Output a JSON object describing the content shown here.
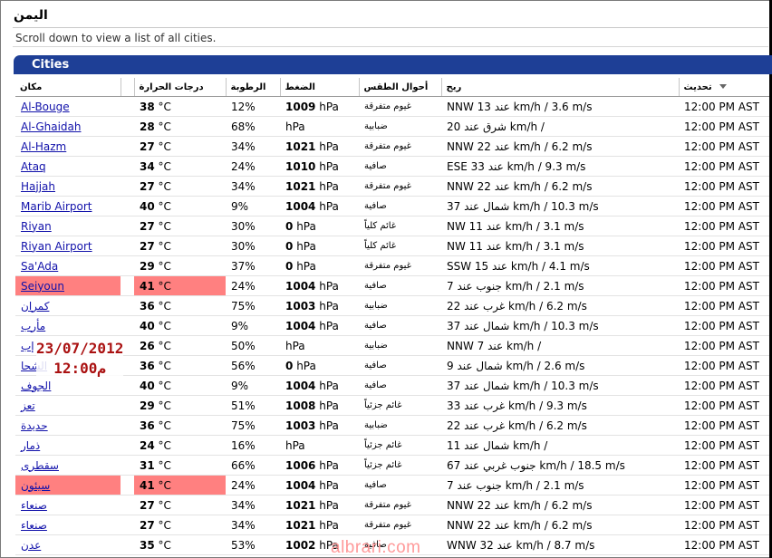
{
  "page": {
    "title": "اليمن",
    "note": "Scroll down to view a list of all cities.",
    "panel_title": "Cities"
  },
  "columns": {
    "city": "مكان",
    "temp": "درجات الحرارة",
    "humidity": "الرطوبة",
    "pressure": "الضغط",
    "conditions": "أحوال الطقس",
    "wind": "ريح",
    "updated": "تحديث"
  },
  "rows": [
    {
      "city": "Al-Bouge",
      "temp": "38",
      "temp_unit": "°C",
      "humidity": "12%",
      "pressure": "1009",
      "pressure_unit": "hPa",
      "conditions": "غيوم متفرقة",
      "wind": "NNW 13 عند km/h / 3.6 m/s",
      "updated": "12:00 PM AST",
      "highlight": false
    },
    {
      "city": "Al-Ghaidah",
      "temp": "28",
      "temp_unit": "°C",
      "humidity": "68%",
      "pressure": "",
      "pressure_unit": "hPa",
      "conditions": "ضبابية",
      "wind": "20 شرق عند km/h /",
      "updated": "12:00 PM AST",
      "highlight": false
    },
    {
      "city": "Al-Hazm",
      "temp": "27",
      "temp_unit": "°C",
      "humidity": "34%",
      "pressure": "1021",
      "pressure_unit": "hPa",
      "conditions": "غيوم متفرقة",
      "wind": "NNW 22 عند km/h / 6.2 m/s",
      "updated": "12:00 PM AST",
      "highlight": false
    },
    {
      "city": "Ataq",
      "temp": "34",
      "temp_unit": "°C",
      "humidity": "24%",
      "pressure": "1010",
      "pressure_unit": "hPa",
      "conditions": "صافية",
      "wind": "ESE 33 عند km/h / 9.3 m/s",
      "updated": "12:00 PM AST",
      "highlight": false
    },
    {
      "city": "Hajjah",
      "temp": "27",
      "temp_unit": "°C",
      "humidity": "34%",
      "pressure": "1021",
      "pressure_unit": "hPa",
      "conditions": "غيوم متفرقة",
      "wind": "NNW 22 عند km/h / 6.2 m/s",
      "updated": "12:00 PM AST",
      "highlight": false
    },
    {
      "city": "Marib Airport",
      "temp": "40",
      "temp_unit": "°C",
      "humidity": "9%",
      "pressure": "1004",
      "pressure_unit": "hPa",
      "conditions": "صافية",
      "wind": "37 شمال عند km/h / 10.3 m/s",
      "updated": "12:00 PM AST",
      "highlight": false
    },
    {
      "city": "Riyan",
      "temp": "27",
      "temp_unit": "°C",
      "humidity": "30%",
      "pressure": "0",
      "pressure_unit": "hPa",
      "conditions": "غائم كلياً",
      "wind": "NW 11 عند km/h / 3.1 m/s",
      "updated": "12:00 PM AST",
      "highlight": false
    },
    {
      "city": "Riyan Airport",
      "temp": "27",
      "temp_unit": "°C",
      "humidity": "30%",
      "pressure": "0",
      "pressure_unit": "hPa",
      "conditions": "غائم كلياً",
      "wind": "NW 11 عند km/h / 3.1 m/s",
      "updated": "12:00 PM AST",
      "highlight": false
    },
    {
      "city": "Sa'Ada",
      "temp": "29",
      "temp_unit": "°C",
      "humidity": "37%",
      "pressure": "0",
      "pressure_unit": "hPa",
      "conditions": "غيوم متفرقة",
      "wind": "SSW 15 عند km/h / 4.1 m/s",
      "updated": "12:00 PM AST",
      "highlight": false
    },
    {
      "city": "Seiyoun",
      "temp": "41",
      "temp_unit": "°C",
      "humidity": "24%",
      "pressure": "1004",
      "pressure_unit": "hPa",
      "conditions": "صافية",
      "wind": "7 جنوب عند km/h / 2.1 m/s",
      "updated": "12:00 PM AST",
      "highlight": true
    },
    {
      "city": "كمران",
      "temp": "36",
      "temp_unit": "°C",
      "humidity": "75%",
      "pressure": "1003",
      "pressure_unit": "hPa",
      "conditions": "ضبابية",
      "wind": "22 غرب عند km/h / 6.2 m/s",
      "updated": "12:00 PM AST",
      "highlight": false
    },
    {
      "city": "مأرب",
      "temp": "40",
      "temp_unit": "°C",
      "humidity": "9%",
      "pressure": "1004",
      "pressure_unit": "hPa",
      "conditions": "صافية",
      "wind": "37 شمال عند km/h / 10.3 m/s",
      "updated": "12:00 PM AST",
      "highlight": false
    },
    {
      "city": "إب",
      "temp": "26",
      "temp_unit": "°C",
      "humidity": "50%",
      "pressure": "",
      "pressure_unit": "hPa",
      "conditions": "ضبابية",
      "wind": "NNW 7 عند km/h /",
      "updated": "12:00 PM AST",
      "highlight": false
    },
    {
      "city": "الشحا",
      "temp": "36",
      "temp_unit": "°C",
      "humidity": "56%",
      "pressure": "0",
      "pressure_unit": "hPa",
      "conditions": "صافية",
      "wind": "9 شمال عند km/h / 2.6 m/s",
      "updated": "12:00 PM AST",
      "highlight": false
    },
    {
      "city": "الجوف",
      "temp": "40",
      "temp_unit": "°C",
      "humidity": "9%",
      "pressure": "1004",
      "pressure_unit": "hPa",
      "conditions": "صافية",
      "wind": "37 شمال عند km/h / 10.3 m/s",
      "updated": "12:00 PM AST",
      "highlight": false
    },
    {
      "city": "تعز",
      "temp": "29",
      "temp_unit": "°C",
      "humidity": "51%",
      "pressure": "1008",
      "pressure_unit": "hPa",
      "conditions": "غائم جزئياً",
      "wind": "33 غرب عند km/h / 9.3 m/s",
      "updated": "12:00 PM AST",
      "highlight": false
    },
    {
      "city": "حديدة",
      "temp": "36",
      "temp_unit": "°C",
      "humidity": "75%",
      "pressure": "1003",
      "pressure_unit": "hPa",
      "conditions": "ضبابية",
      "wind": "22 غرب عند km/h / 6.2 m/s",
      "updated": "12:00 PM AST",
      "highlight": false
    },
    {
      "city": "ذمار",
      "temp": "24",
      "temp_unit": "°C",
      "humidity": "16%",
      "pressure": "",
      "pressure_unit": "hPa",
      "conditions": "غائم جزئياً",
      "wind": "11 شمال عند km/h /",
      "updated": "12:00 PM AST",
      "highlight": false
    },
    {
      "city": "سقطرى",
      "temp": "31",
      "temp_unit": "°C",
      "humidity": "66%",
      "pressure": "1006",
      "pressure_unit": "hPa",
      "conditions": "غائم جزئياً",
      "wind": "67 جنوب غربي عند km/h / 18.5 m/s",
      "updated": "12:00 PM AST",
      "highlight": false
    },
    {
      "city": "سيئون",
      "temp": "41",
      "temp_unit": "°C",
      "humidity": "24%",
      "pressure": "1004",
      "pressure_unit": "hPa",
      "conditions": "صافية",
      "wind": "7 جنوب عند km/h / 2.1 m/s",
      "updated": "12:00 PM AST",
      "highlight": true
    },
    {
      "city": "صنعاء",
      "temp": "27",
      "temp_unit": "°C",
      "humidity": "34%",
      "pressure": "1021",
      "pressure_unit": "hPa",
      "conditions": "غيوم متفرقة",
      "wind": "NNW 22 عند km/h / 6.2 m/s",
      "updated": "12:00 PM AST",
      "highlight": false
    },
    {
      "city": "صنعاء",
      "temp": "27",
      "temp_unit": "°C",
      "humidity": "34%",
      "pressure": "1021",
      "pressure_unit": "hPa",
      "conditions": "غيوم متفرقة",
      "wind": "NNW 22 عند km/h / 6.2 m/s",
      "updated": "12:00 PM AST",
      "highlight": false
    },
    {
      "city": "عدن",
      "temp": "35",
      "temp_unit": "°C",
      "humidity": "53%",
      "pressure": "1002",
      "pressure_unit": "hPa",
      "conditions": "صافية",
      "wind": "WNW 32 عند km/h / 8.7 m/s",
      "updated": "12:00 PM AST",
      "highlight": false
    }
  ],
  "overlay": {
    "date": "23/07/2012",
    "time": "12:00م"
  },
  "watermark": "albrari.com",
  "colors": {
    "panel_header": "#1e3f96",
    "highlight": "#ff8080",
    "link": "#1111aa",
    "stamp": "#aa1111"
  },
  "icons": {
    "sort": "sort-descending-icon"
  }
}
